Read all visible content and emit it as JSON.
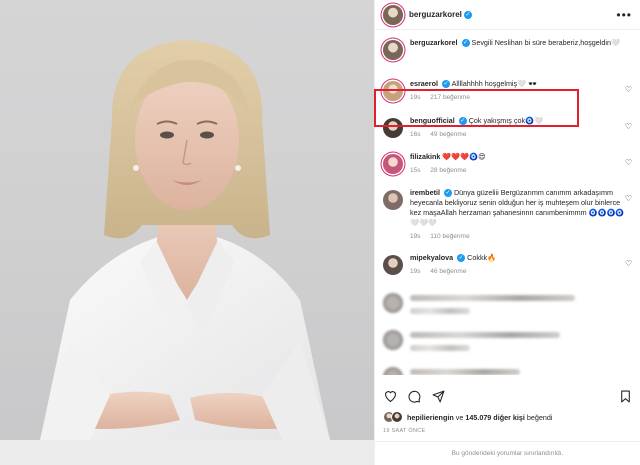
{
  "header": {
    "username": "berguzarkorel",
    "more_label": "•••"
  },
  "comments": [
    {
      "user": "berguzarkorel",
      "text": "Sevgili Neslihan bi süre beraberiz,hoşgeldin🤍",
      "time": "",
      "likes": ""
    },
    {
      "user": "esraerol",
      "text": "Allllahhhh hoşgelmiş🤍 🕶️",
      "time": "19s",
      "likes": "217 beğenme"
    },
    {
      "user": "benguofficial",
      "text": "Çok yakışmış çok🧿🤍",
      "time": "16s",
      "likes": "49 beğenme"
    },
    {
      "user": "filizakink",
      "text": "❤️❤️❤️🧿😍",
      "time": "15s",
      "likes": "28 beğenme"
    },
    {
      "user": "irembetil",
      "text": "Dünya güzeliii Bergüzarımm canımm arkadaşımm heyecanla bekliyoruz senin olduğun her iş muhteşem olur binlerce kez maşaAllah herzaman şahanesinnn canımbenimmm 🧿🧿🧿🧿🤍🤍🤍",
      "time": "19s",
      "likes": "110 beğenme"
    },
    {
      "user": "mipekyalova",
      "text": "Cokkk🔥",
      "time": "19s",
      "likes": "46 beğenme"
    }
  ],
  "likes_line": {
    "user": "hepilieriengin",
    "connector": "ve",
    "count": "145.079 diğer kişi",
    "suffix": "beğendi"
  },
  "date": "19 SAAT ÖNCE",
  "footer": "Bu gönderideki yorumlar sınırlandırıldı.",
  "icons": [
    "heart-icon",
    "comment-icon",
    "share-icon",
    "bookmark-icon"
  ],
  "colors": {
    "highlight": "#e0202e",
    "verified": "#1d9bf0"
  }
}
